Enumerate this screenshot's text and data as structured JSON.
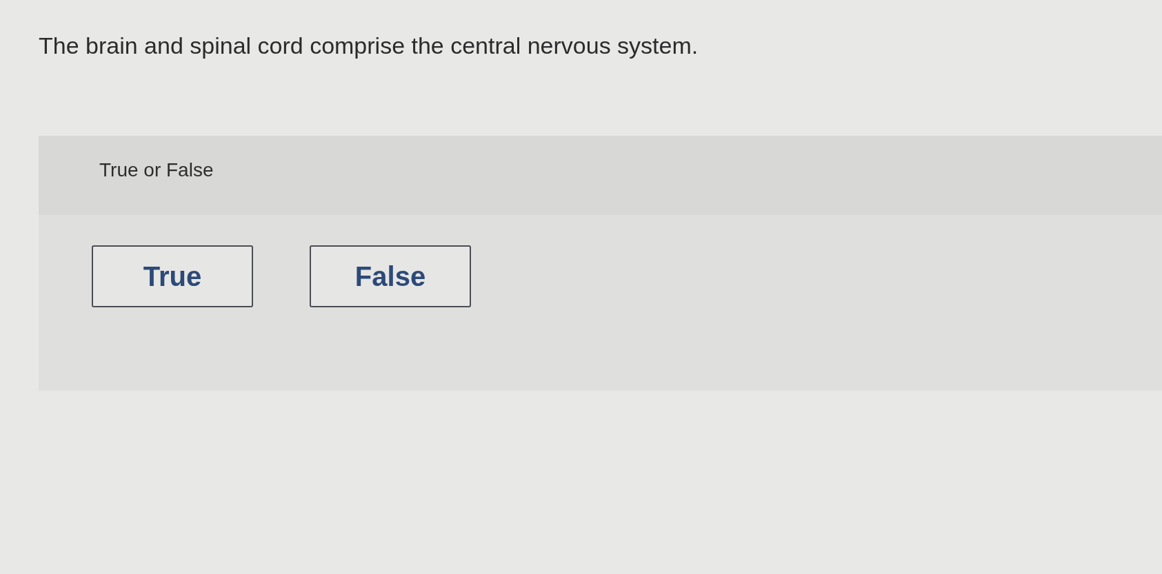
{
  "question": "The brain and spinal cord comprise the central nervous system.",
  "answer_panel": {
    "prompt": "True or False",
    "options": [
      {
        "label": "True",
        "selected": false
      },
      {
        "label": "False",
        "selected": false
      }
    ]
  }
}
